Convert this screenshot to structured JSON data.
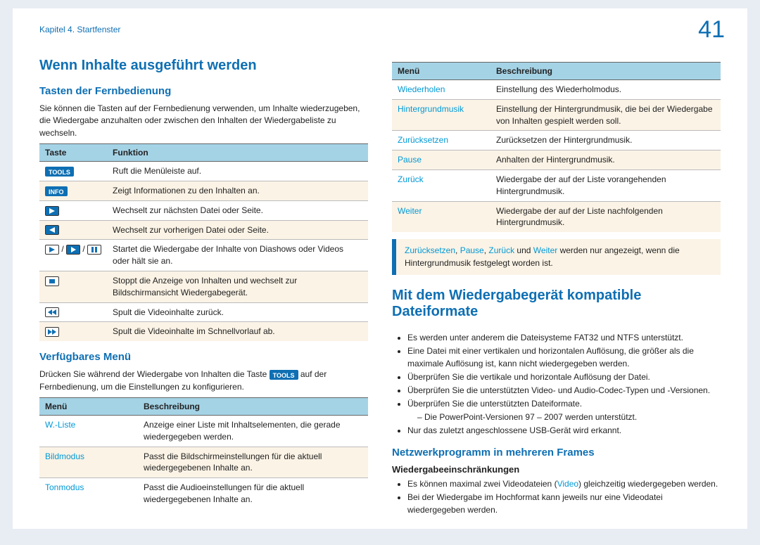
{
  "header": {
    "breadcrumb": "Kapitel 4. Startfenster",
    "pageNumber": "41"
  },
  "left": {
    "title": "Wenn Inhalte ausgeführt werden",
    "section1": {
      "heading": "Tasten der Fernbedienung",
      "intro": "Sie können die Tasten auf der Fernbedienung verwenden, um Inhalte wiederzugeben, die Wiedergabe anzuhalten oder zwischen den Inhalten der Wiedergabeliste zu wechseln.",
      "table": {
        "headers": [
          "Taste",
          "Funktion"
        ],
        "rows": [
          {
            "iconSet": [
              "TOOLS"
            ],
            "desc": "Ruft die Menüleiste auf."
          },
          {
            "iconSet": [
              "INFO"
            ],
            "desc": "Zeigt Informationen zu den Inhalten an."
          },
          {
            "iconSet": [
              "next"
            ],
            "desc": "Wechselt zur nächsten Datei oder Seite."
          },
          {
            "iconSet": [
              "prev"
            ],
            "desc": "Wechselt zur vorherigen Datei oder Seite."
          },
          {
            "iconSet": [
              "play",
              "playR",
              "pause"
            ],
            "desc": "Startet die Wiedergabe der Inhalte von Diashows oder Videos oder hält sie an."
          },
          {
            "iconSet": [
              "stop"
            ],
            "desc": "Stoppt die Anzeige von Inhalten und wechselt zur Bildschirmansicht Wiedergabegerät."
          },
          {
            "iconSet": [
              "rew"
            ],
            "desc": "Spult die Videoinhalte zurück."
          },
          {
            "iconSet": [
              "ffwd"
            ],
            "desc": "Spult die Videoinhalte im Schnellvorlauf ab."
          }
        ]
      }
    },
    "section2": {
      "heading": "Verfügbares Menü",
      "intro_a": "Drücken Sie während der Wiedergabe von Inhalten die Taste ",
      "intro_tools": "TOOLS",
      "intro_b": " auf der Fernbedienung, um die Einstellungen zu konfigurieren.",
      "table": {
        "headers": [
          "Menü",
          "Beschreibung"
        ],
        "rows": [
          {
            "label": "W.-Liste",
            "desc": "Anzeige einer Liste mit Inhaltselementen, die gerade wiedergegeben werden."
          },
          {
            "label": "Bildmodus",
            "desc": "Passt die Bildschirmeinstellungen für die aktuell wiedergegebenen Inhalte an."
          },
          {
            "label": "Tonmodus",
            "desc": "Passt die Audioeinstellungen für die aktuell wiedergegebenen Inhalte an."
          }
        ]
      }
    }
  },
  "right": {
    "table": {
      "headers": [
        "Menü",
        "Beschreibung"
      ],
      "rows": [
        {
          "label": "Wiederholen",
          "desc": "Einstellung des Wiederholmodus."
        },
        {
          "label": "Hintergrundmusik",
          "desc": "Einstellung der Hintergrundmusik, die bei der Wiedergabe von Inhalten gespielt werden soll."
        },
        {
          "label": "Zurücksetzen",
          "desc": "Zurücksetzen der Hintergrundmusik."
        },
        {
          "label": "Pause",
          "desc": "Anhalten der Hintergrundmusik."
        },
        {
          "label": "Zurück",
          "desc": "Wiedergabe der auf der Liste vorangehenden Hintergrundmusik."
        },
        {
          "label": "Weiter",
          "desc": "Wiedergabe der auf der Liste nachfolgenden Hintergrundmusik."
        }
      ]
    },
    "note": {
      "h1": "Zurücksetzen",
      "c1": ", ",
      "h2": "Pause",
      "c2": ", ",
      "h3": "Zurück",
      "c3": " und ",
      "h4": "Weiter",
      "tail": " werden nur angezeigt, wenn die Hintergrundmusik festgelegt worden ist."
    },
    "section2": {
      "heading": "Mit dem Wiedergabegerät kompatible Dateiformate",
      "bullets": [
        "Es werden unter anderem die Dateisysteme FAT32 und NTFS unterstützt.",
        "Eine Datei mit einer vertikalen und horizontalen Auflösung, die größer als die maximale Auflösung ist, kann nicht wiedergegeben werden.",
        "Überprüfen Sie die vertikale und horizontale Auflösung der Datei.",
        "Überprüfen Sie die unterstützten Video- und Audio-Codec-Typen und -Versionen.",
        "Überprüfen Sie die unterstützten Dateiformate."
      ],
      "sub": "Die PowerPoint-Versionen 97 – 2007 werden unterstützt.",
      "bullet_last": "Nur das zuletzt angeschlossene USB-Gerät wird erkannt.",
      "sub2": {
        "heading": "Netzwerkprogramm in mehreren Frames",
        "h3": "Wiedergabeeinschränkungen",
        "b1a": "Es können maximal zwei Videodateien (",
        "b1link": "Video",
        "b1b": ") gleichzeitig wiedergegeben werden.",
        "b2": "Bei der Wiedergabe im Hochformat kann jeweils nur eine Videodatei wiedergegeben werden."
      }
    }
  }
}
